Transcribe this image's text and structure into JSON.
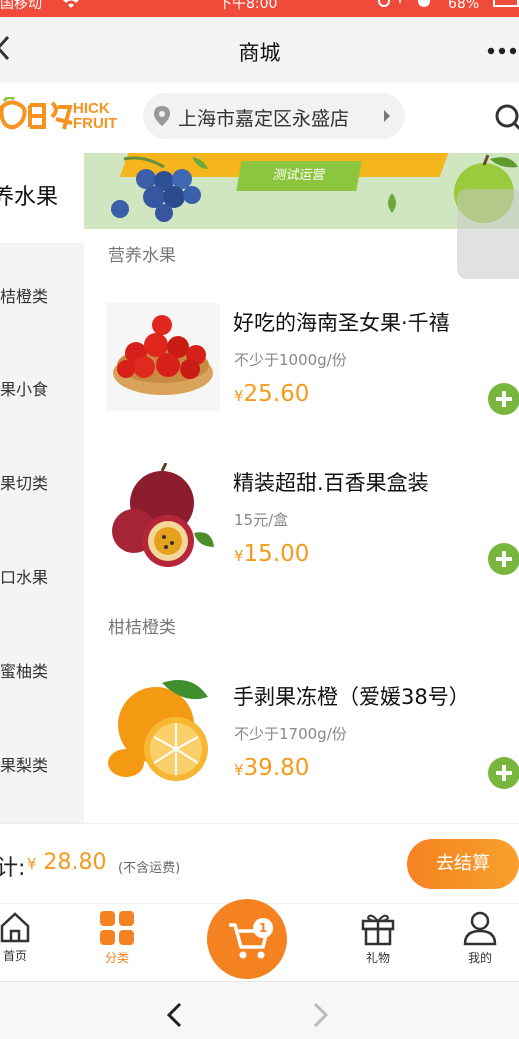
{
  "status_bar": {
    "carrier": "国移动",
    "time": "下午8:00",
    "battery": "68%"
  },
  "nav": {
    "title": "商城"
  },
  "store": {
    "logo_text_line1": "HICK",
    "logo_text_line2": "FRUIT",
    "location": "上海市嘉定区永盛店"
  },
  "sidebar": {
    "items": [
      {
        "label": "养水果",
        "active": true
      },
      {
        "label": "桔橙类"
      },
      {
        "label": "果小食"
      },
      {
        "label": "果切类"
      },
      {
        "label": "口水果"
      },
      {
        "label": "蜜柚类"
      },
      {
        "label": "果梨类"
      }
    ]
  },
  "banner": {
    "tag": "测试运营"
  },
  "sections": [
    {
      "title": "营养水果",
      "products": [
        {
          "name": "好吃的海南圣女果·千禧",
          "spec": "不少于1000g/份",
          "currency": "¥",
          "price": "25.60"
        },
        {
          "name": "精装超甜.百香果盒装",
          "spec": "15元/盒",
          "currency": "¥",
          "price": "15.00"
        }
      ]
    },
    {
      "title": "柑桔橙类",
      "products": [
        {
          "name": "手剥果冻橙（爱媛38号）",
          "spec": "不少于1700g/份",
          "currency": "¥",
          "price": "39.80"
        }
      ]
    }
  ],
  "cart": {
    "total_label": "计:",
    "currency": "¥",
    "total": "28.80",
    "note": "(不含运费)",
    "checkout_label": "去结算",
    "badge_count": "1"
  },
  "tabbar": {
    "items": [
      {
        "label": "首页",
        "icon": "home-icon"
      },
      {
        "label": "分类",
        "icon": "category-icon",
        "active": true
      },
      {
        "label": "",
        "icon": "cart-icon"
      },
      {
        "label": "礼物",
        "icon": "gift-icon"
      },
      {
        "label": "我的",
        "icon": "user-icon"
      }
    ]
  },
  "colors": {
    "accent": "#f58220",
    "price": "#f59a1b",
    "add_button": "#78b640",
    "status_bar": "#f04a3a"
  }
}
